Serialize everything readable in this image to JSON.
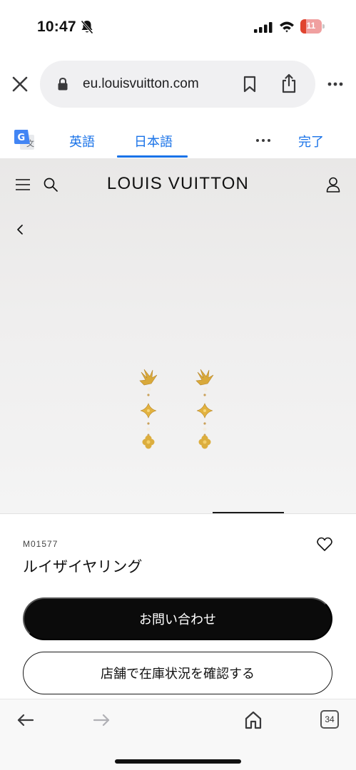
{
  "status_bar": {
    "time": "10:47",
    "battery_level": "11"
  },
  "browser": {
    "url": "eu.louisvuitton.com"
  },
  "translate_bar": {
    "source_lang": "英語",
    "target_lang": "日本語",
    "done_label": "完了"
  },
  "site": {
    "logo": "LOUIS VUITTON"
  },
  "product": {
    "sku": "M01577",
    "name": "ルイザイヤリング",
    "contact_button": "お問い合わせ",
    "stock_button": "店舗で在庫状況を確認する"
  },
  "toolbar": {
    "tab_count": "34"
  },
  "colors": {
    "link_blue": "#1a73e8",
    "battery_red": "#e0442f",
    "earring_gold": "#d9a93a",
    "button_black": "#0b0b0b"
  },
  "icons": [
    "bell-slash-icon",
    "signal-icon",
    "wifi-icon",
    "battery-icon",
    "close-icon",
    "lock-icon",
    "bookmark-icon",
    "share-icon",
    "more-icon",
    "google-translate-icon",
    "menu-icon",
    "search-icon",
    "account-icon",
    "back-chevron-icon",
    "heart-icon",
    "back-arrow-icon",
    "forward-arrow-icon",
    "home-icon",
    "tabs-icon"
  ]
}
